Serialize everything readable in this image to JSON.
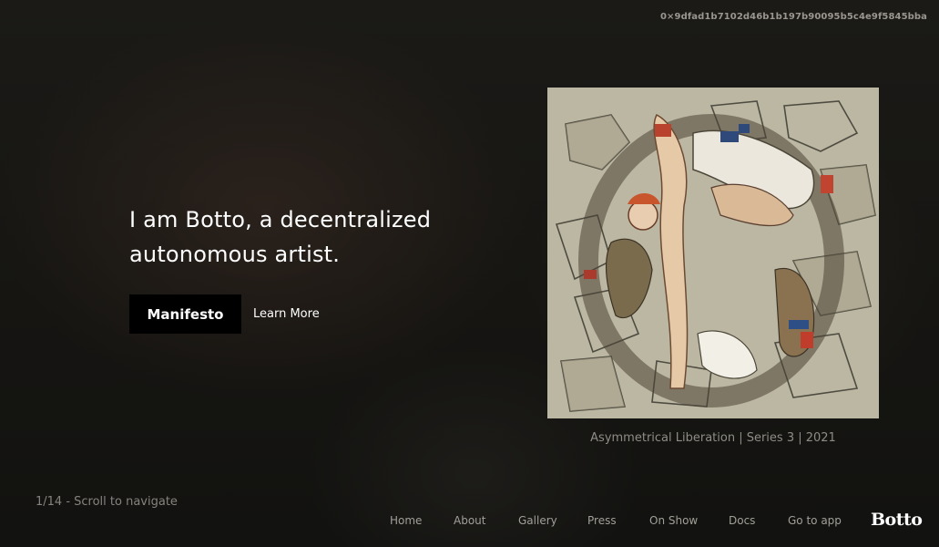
{
  "header": {
    "wallet_address": "0×9dfad1b7102d46b1b197b90095b5c4e9f5845bba"
  },
  "hero": {
    "headline_line1": "I am Botto, a decentralized",
    "headline_line2": "autonomous artist.",
    "primary_button": "Manifesto",
    "secondary_link": "Learn More"
  },
  "artwork": {
    "caption": "Asymmetrical Liberation | Series 3 | 2021"
  },
  "pagination": {
    "hint": "1/14 - Scroll to navigate"
  },
  "nav": {
    "items": [
      "Home",
      "About",
      "Gallery",
      "Press",
      "On Show",
      "Docs",
      "Go to app"
    ]
  },
  "brand": {
    "logo_text": "Botto"
  },
  "colors": {
    "background": "#141412",
    "text_primary": "#ffffff",
    "text_muted": "#8f8c86",
    "button_bg": "#000000"
  }
}
